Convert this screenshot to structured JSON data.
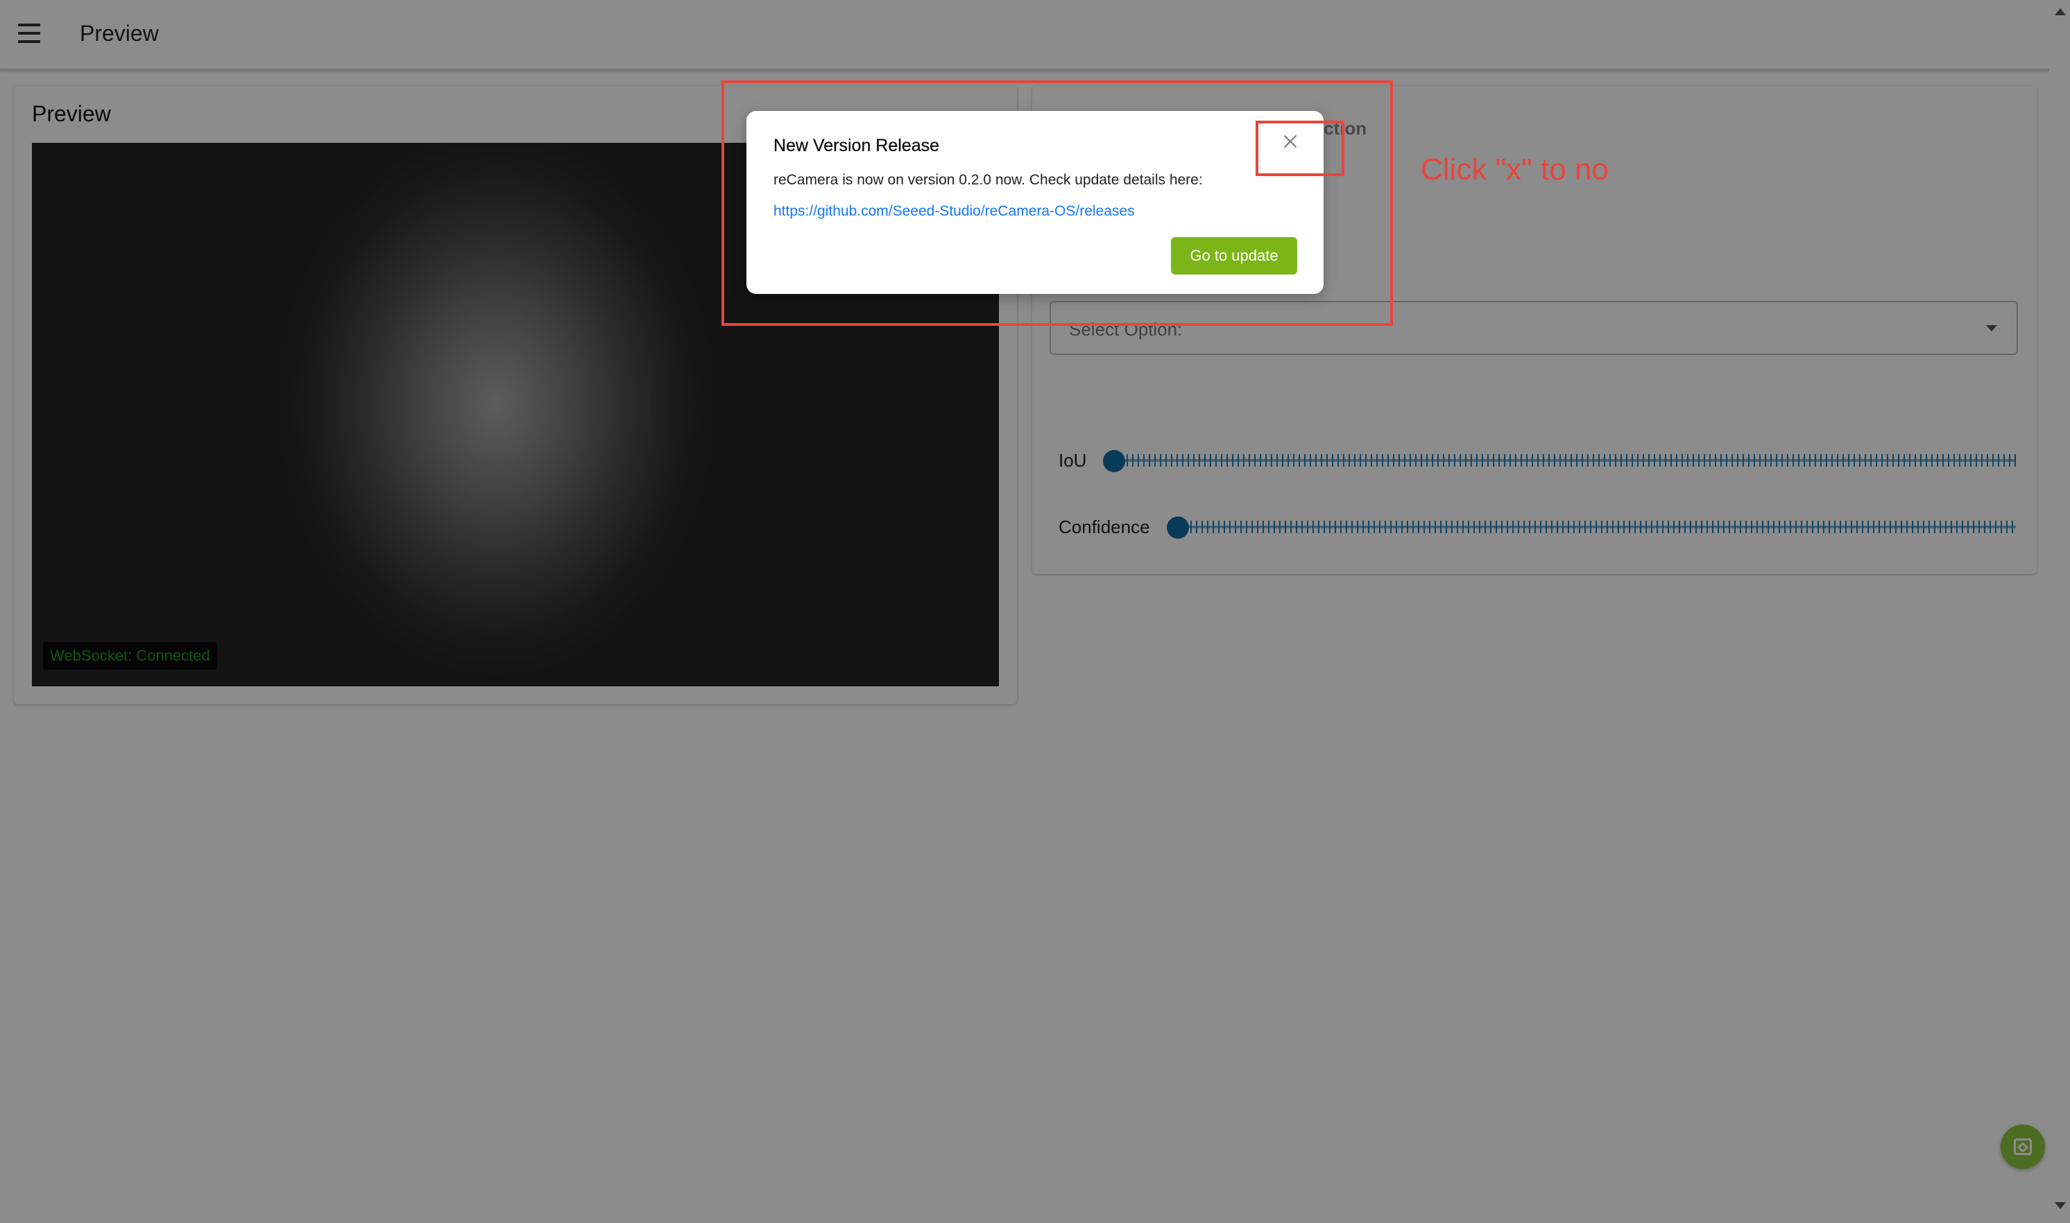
{
  "appbar": {
    "title": "Preview",
    "menu_icon": "menu-icon"
  },
  "preview": {
    "title": "Preview",
    "websocket_status": "WebSocket: Connected"
  },
  "settings": {
    "title_visible": "ction",
    "select_placeholder": "Select Option:",
    "sliders": [
      {
        "label": "IoU",
        "value": 0
      },
      {
        "label": "Confidence",
        "value": 0
      }
    ]
  },
  "modal": {
    "title": "New Version Release",
    "text": "reCamera is now on version 0.2.0 now. Check update details here:",
    "link": "https://github.com/Seeed-Studio/reCamera-OS/releases",
    "button": "Go to update",
    "close_icon": "close-icon"
  },
  "annotation": {
    "text": "Click \"x\" to no",
    "color": "#e8453c"
  },
  "fab": {
    "icon": "code-icon",
    "color": "#8cc63f"
  },
  "colors": {
    "accent_green": "#7cb518",
    "link_blue": "#1677ff",
    "slider_blue": "#0f6aa3",
    "ws_green": "#1aa01a"
  }
}
